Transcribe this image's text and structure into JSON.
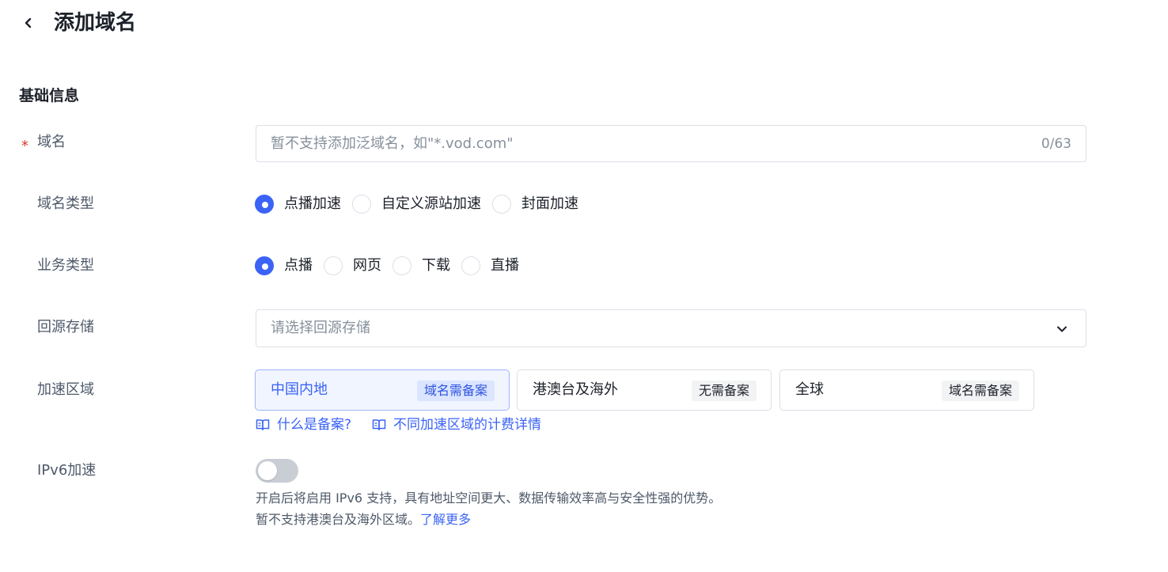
{
  "header": {
    "title": "添加域名",
    "back_icon": "chevron-left-icon"
  },
  "basic_info": {
    "section_title": "基础信息",
    "domain": {
      "label": "域名",
      "required": "*",
      "placeholder": "暂不支持添加泛域名，如\"*.vod.com\"",
      "value": "",
      "char_count": "0/63"
    },
    "domain_type": {
      "label": "域名类型",
      "options": [
        "点播加速",
        "自定义源站加速",
        "封面加速"
      ],
      "selected": "点播加速"
    },
    "business_type": {
      "label": "业务类型",
      "options": [
        "点播",
        "网页",
        "下载",
        "直播"
      ],
      "selected": "点播"
    },
    "origin_storage": {
      "label": "回源存储",
      "placeholder": "请选择回源存储",
      "icon": "chevron-down-icon"
    },
    "accel_region": {
      "label": "加速区域",
      "cards": [
        {
          "name": "中国内地",
          "badge": "域名需备案"
        },
        {
          "name": "港澳台及海外",
          "badge": "无需备案"
        },
        {
          "name": "全球",
          "badge": "域名需备案"
        }
      ],
      "selected": "中国内地",
      "links": [
        "什么是备案?",
        "不同加速区域的计费详情"
      ]
    },
    "ipv6": {
      "label": "IPv6加速",
      "enabled": false,
      "desc_line1": "开启后将启用 IPv6 支持，具有地址空间更大、数据传输效率高与安全性强的优势。",
      "desc_line2": "暂不支持港澳台及海外区域。",
      "learn_more": "了解更多"
    }
  },
  "colors": {
    "primary": "#3b63f5",
    "required": "#d33a2c",
    "border": "#dcdfe6",
    "muted": "#86909c"
  }
}
